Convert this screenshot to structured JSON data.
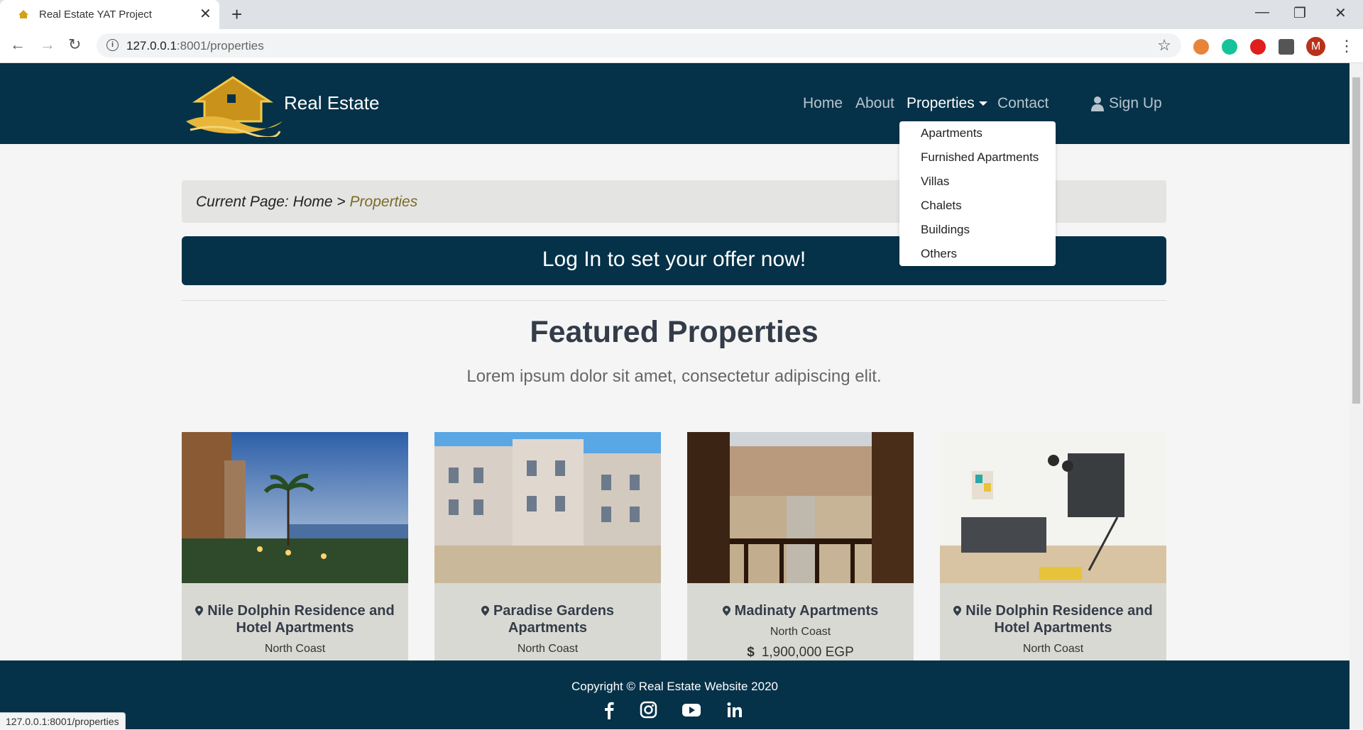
{
  "browser": {
    "tab_title": "Real Estate YAT Project",
    "url_host": "127.0.0.1",
    "url_rest": ":8001/properties",
    "profile_initial": "M",
    "status_url": "127.0.0.1:8001/properties"
  },
  "navbar": {
    "brand": "Real Estate",
    "links": [
      "Home",
      "About",
      "Properties",
      "Contact"
    ],
    "signup": "Sign Up"
  },
  "dropdown": {
    "items": [
      "Apartments",
      "Furnished Apartments",
      "Villas",
      "Chalets",
      "Buildings",
      "Others"
    ]
  },
  "breadcrumb": {
    "prefix": "Current Page: Home > ",
    "current": "Properties"
  },
  "cta": "Log In to set your offer now!",
  "featured": {
    "title": "Featured Properties",
    "subtitle": "Lorem ipsum dolor sit amet, consectetur adipiscing elit."
  },
  "cards": [
    {
      "title": "Nile Dolphin Residence and Hotel Apartments",
      "location": "North Coast",
      "price": ""
    },
    {
      "title": "Paradise Gardens Apartments",
      "location": "North Coast",
      "price": ""
    },
    {
      "title": "Madinaty Apartments",
      "location": "North Coast",
      "price": "1,900,000 EGP"
    },
    {
      "title": "Nile Dolphin Residence and Hotel Apartments",
      "location": "North Coast",
      "price": ""
    }
  ],
  "footer": {
    "copyright": "Copyright © Real Estate Website 2020",
    "social_icons": [
      "facebook-icon",
      "instagram-icon",
      "youtube-icon",
      "linkedin-icon"
    ]
  },
  "colors": {
    "navy": "#053249",
    "gold": "#d4a017",
    "card_bg": "#d9d9d4"
  }
}
